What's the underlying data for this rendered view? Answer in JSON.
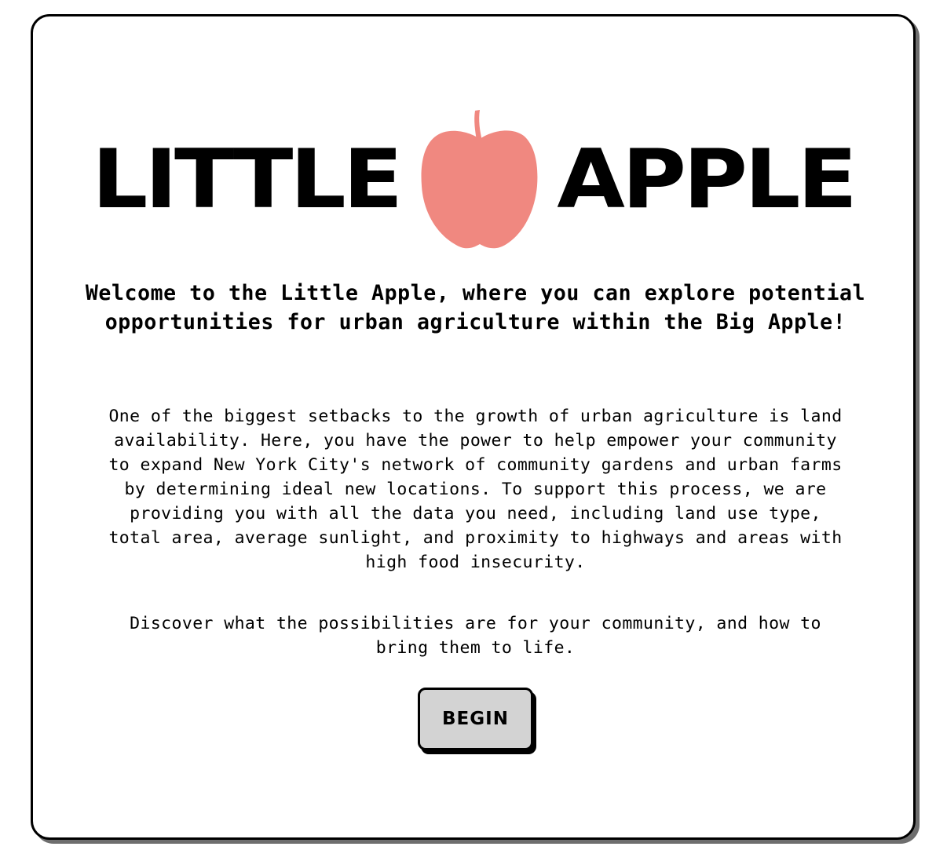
{
  "logo": {
    "word_left": "LITTLE",
    "word_right": "APPLE",
    "icon": "apple-icon",
    "apple_color": "#f08880"
  },
  "headline": "Welcome to the Little Apple, where you can explore potential opportunities for urban agriculture within the Big Apple!",
  "description": "One of the biggest setbacks to the growth of urban agriculture is land availability. Here, you have the power to help empower your community to expand New York City's network of community gardens and urban farms by determining ideal new locations. To support this process, we are providing you with all the data you need, including land use type, total area, average sunlight, and proximity to highways and areas with high food insecurity.",
  "call_to_action": "Discover what the possibilities are for your community, and how to bring them to life.",
  "begin_button": {
    "label": "BEGIN",
    "background": "#d3d3d3"
  }
}
